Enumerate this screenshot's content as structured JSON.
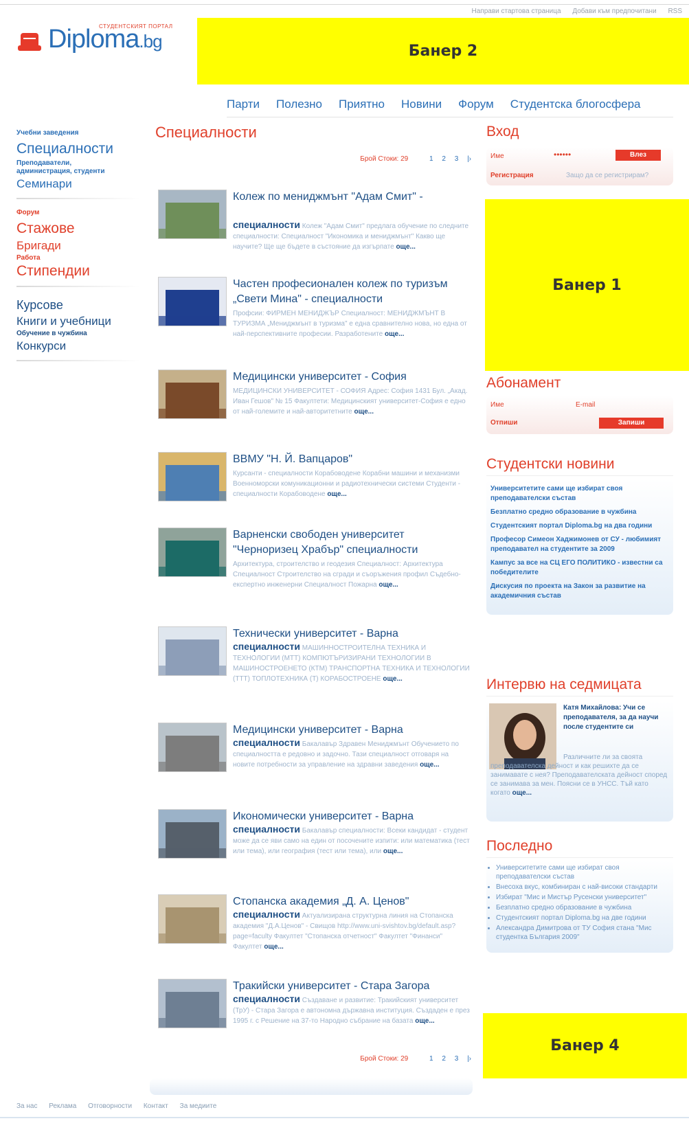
{
  "top_links": [
    "Направи стартова страница",
    "Добави към предпочитани",
    "RSS"
  ],
  "logo": {
    "text": "Diploma",
    "suffix": ".bg",
    "tagline": "СТУДЕНТСКИЯТ ПОРТАЛ"
  },
  "banners": {
    "b2": "Банер 2",
    "b1": "Банер 1",
    "b4": "Банер 4"
  },
  "nav": [
    "Парти",
    "Полезно",
    "Приятно",
    "Новини",
    "Форум",
    "Студентска блогосфера"
  ],
  "left": {
    "g1_small": "Учебни заведения",
    "g1_big": "Специалности",
    "g1_small2": "Преподаватели, администрация, студенти",
    "g1_mid": "Семинари",
    "g2_small": "Форум",
    "g2_big": "Стажове",
    "g2_mid": "Бригади",
    "g2_small2": "Работа",
    "g2_big2": "Стипендии",
    "g3_a": "Курсове",
    "g3_b": "Книги и учебници",
    "g3_small": "Обучение в чужбина",
    "g3_c": "Конкурси"
  },
  "main": {
    "title": "Специалности",
    "pager_label": "Брой Стоки: 29",
    "pages": [
      "1",
      "2",
      "3",
      "|›"
    ],
    "more": "още...",
    "items": [
      {
        "title": "Колеж по мениджмънт \"Адам Смит\" -",
        "subtitle": "специалности",
        "desc": "Колеж \"Адам Смит\" предлага обучение по следните специалности: Специалност \"Икономика и мениджмънт\" Какво ще научите? Ще ще бъдете в състояние да изгърпате"
      },
      {
        "title": "Частен професионален колеж по туризъм „Свети Мина\" - специалности",
        "subtitle": "",
        "desc": "Профсии: ФИРМЕН МЕНИДЖЪР Специалност: МЕНИДЖМЪНТ В ТУРИЗМА „Мениджмънт в туризма\" е една сравнително нова, но една от най-перспективните професии. Разработените"
      },
      {
        "title": "Медицински университет - София",
        "subtitle": "",
        "desc": "МЕДИЦИНСКИ УНИВЕРСИТЕТ - СОФИЯ Адрес: София 1431 Бул. „Акад. Иван Гешов\" № 15 Факултети: Медицинският университет-София е едно от най-големите и най-авторитетните"
      },
      {
        "title": "ВВМУ \"Н. Й. Вапцаров\"",
        "subtitle": "",
        "desc": "Курсанти - специалности Корабоводене Корабни машини и механизми Военноморски комуникационни и радиотехнически системи Студенти - специалности Корабоводене"
      },
      {
        "title": "Варненски свободен университет \"Черноризец Храбър\" специалности",
        "subtitle": "",
        "desc": "Архитектура, строителство и геодезия Специалност: Архитектура Специалност Строителство на сгради и съоръжения профил Съдебно-експертно инженерни Специалност Пожарна"
      },
      {
        "title": "Технически университет - Варна",
        "subtitle": "специалности",
        "desc": "МАШИННОСТРОИТЕЛНА ТЕХНИКА И ТЕХНОЛОГИИ (МТТ) КОМПЮТЪРИЗИРАНИ ТЕХНОЛОГИИ В МАШИНОСТРОЕНЕТО (КТМ) ТРАНСПОРТНА ТЕХНИКА И ТЕХНОЛОГИИ (ТТТ) ТОПЛОТЕХНИКА (Т) КОРАБОСТРОЕНЕ"
      },
      {
        "title": "Медицински университет - Варна",
        "subtitle": "специалности",
        "desc": "Бакалавър Здравен Мениджмънт Обучението по специалността е редовно и задочно. Тази специалност отговаря на новите потребности за управление на здравни заведения"
      },
      {
        "title": "Икономически университет - Варна",
        "subtitle": "специалности",
        "desc": "Бакалавър специалности: Всеки кандидат - студент може да се яви само на един от посочените изпити: или математика (тест или тема), или география (тест или тема), или"
      },
      {
        "title": "Стопанска академия „Д. А. Ценов\"",
        "subtitle": "специалности",
        "desc": "Актуализирана структурна линия на Стопанска академия \"Д.А.Ценов\" - Свищов http://www.uni-svishtov.bg/default.asp?page=faculty Факултет \"Стопанска отчетност\" Факултет \"Финанси\" Факултет"
      },
      {
        "title": "Тракийски университет - Стара Загора",
        "subtitle": "специалности",
        "desc": "Създаване и развитие: Тракийският университет (ТрУ) - Стара Загора е автономна държавна институция. Създаден е през 1995 г. с Решение на 37-то Народно събрание на базата"
      }
    ]
  },
  "login": {
    "heading": "Вход",
    "user_label": "Име",
    "password": "••••••",
    "button": "Влез",
    "register": "Регистрация",
    "why": "Защо да се регистрирам?"
  },
  "subscribe": {
    "heading": "Абонамент",
    "name_label": "Име",
    "email_label": "E-mail",
    "unsubscribe": "Отпиши",
    "button": "Запиши"
  },
  "student_news": {
    "heading": "Студентски новини",
    "items": [
      "Университетите сами ще избират своя преподавателски състав",
      "Безплатно средно образование в чужбина",
      "Студентският портал Diploma.bg на два години",
      "Професор Симеон Хаджимонев от СУ - любимият преподавател на студентите за 2009",
      "Кампус за все на СЦ ЕГО ПОЛИТИКО - известни са победителите",
      "Дискусия по проекта на Закон за развитие на академичния състав"
    ]
  },
  "interview": {
    "heading": "Интервю на седмицата",
    "lead": "Катя Михайлова: Учи се преподавателя, за да научи после студентите си",
    "text": "Различните ли за своята преподавателска дейност и как решихте да се занимавате с нея? Преподавателската дейност според се занимава за мен. Поясни се в УНСС. Тъй като когато",
    "more": "още..."
  },
  "last": {
    "heading": "Последно",
    "items": [
      "Университетите сами ще избират своя преподавателски състав",
      "Внесоха вкус, комбиниран с най-високи стандарти",
      "Избират \"Мис и Мистър Русенски университет\"",
      "Безплатно средно образование в чужбина",
      "Студентският портал Diploma.bg на две години",
      "Александра Димитрова от ТУ София стана \"Мис студентка България 2009\""
    ]
  },
  "footer": [
    "За нас",
    "Реклама",
    "Отговорности",
    "Контакт",
    "За медиите"
  ]
}
